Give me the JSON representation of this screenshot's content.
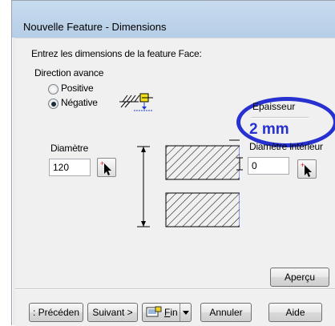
{
  "window": {
    "title": "Nouvelle Feature - Dimensions"
  },
  "prompt": "Entrez les dimensions de la feature Face:",
  "direction": {
    "label": "Direction avance",
    "options": [
      {
        "label": "Positive",
        "selected": false
      },
      {
        "label": "Négative",
        "selected": true
      }
    ]
  },
  "thickness": {
    "label": "Epaisseur",
    "value": "2 mm",
    "highlight_color": "#2631cf"
  },
  "diameter": {
    "label": "Diamètre",
    "value": "120"
  },
  "inner_diameter": {
    "label": "Diamètre intérieur",
    "value": "0"
  },
  "buttons": {
    "preview": "Aperçu",
    "previous": ": Précéden",
    "next": "Suivant >",
    "finish_letter": "F",
    "finish_rest": "in",
    "cancel": "Annuler",
    "help": "Aide"
  },
  "icons": {
    "direction": "negative-direction-icon",
    "pick": "pick-arrow-icon",
    "finish": "finish-icon",
    "dropdown": "dropdown-arrow-icon"
  }
}
